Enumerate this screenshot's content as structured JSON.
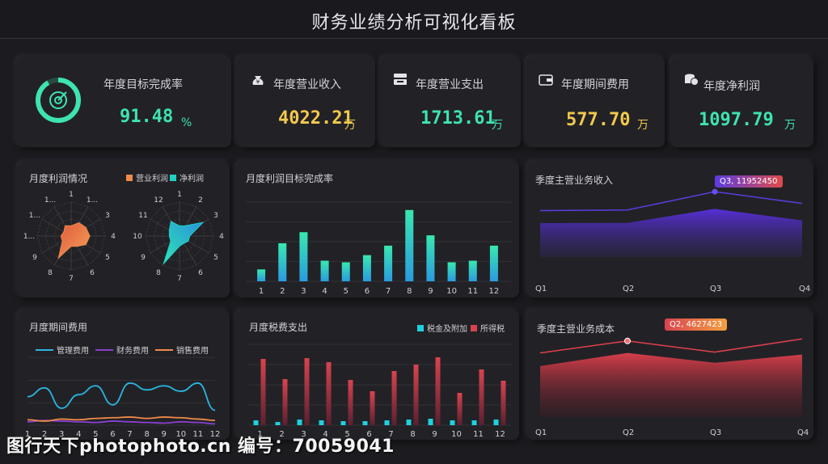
{
  "header": {
    "title": "财务业绩分析可视化看板"
  },
  "kpis": [
    {
      "label": "年度目标完成率",
      "value": "91.48",
      "unit": "%",
      "color": "#3ee3b0",
      "icon": "target-ring-icon"
    },
    {
      "label": "年度营业收入",
      "value": "4022.21",
      "unit": "万",
      "color": "#f2c94c",
      "icon": "money-bag-icon"
    },
    {
      "label": "年度营业支出",
      "value": "1713.61",
      "unit": "万",
      "color": "#3ee3b0",
      "icon": "cash-register-icon"
    },
    {
      "label": "年度期间费用",
      "value": "577.70",
      "unit": "万",
      "color": "#f2c94c",
      "icon": "wallet-icon"
    },
    {
      "label": "年度净利润",
      "value": "1097.79",
      "unit": "万",
      "color": "#3ee3b0",
      "icon": "coin-stack-icon"
    }
  ],
  "panels": {
    "profit_radar": {
      "title": "月度利润情况",
      "legend": [
        "营业利润",
        "净利润"
      ]
    },
    "profit_target": {
      "title": "月度利润目标完成率"
    },
    "quarter_revenue": {
      "title": "季度主营业务收入",
      "tooltip": "Q3, 11952450"
    },
    "period_expense": {
      "title": "月度期间费用",
      "legend": [
        "管理费用",
        "财务费用",
        "销售费用"
      ]
    },
    "tax": {
      "title": "月度税费支出",
      "legend": [
        "税金及附加",
        "所得税"
      ]
    },
    "quarter_cost": {
      "title": "季度主营业务成本",
      "tooltip": "Q2, 4627423"
    }
  },
  "watermark": "图行天下photophoto.cn 编号：70059041",
  "colors": {
    "green": "#3ee3b0",
    "yellow": "#f2c94c",
    "orange": "#f08a4b",
    "teal": "#1fd1c4",
    "blue": "#2ab6e0",
    "purple": "#6a3be0",
    "red": "#d9434f"
  },
  "chart_data": [
    {
      "type": "radar",
      "title": "月度利润情况",
      "categories": [
        "1",
        "2",
        "3",
        "4",
        "5",
        "6",
        "7",
        "8",
        "9",
        "10",
        "11",
        "12"
      ],
      "tick_labels_left": [
        "1",
        "1...",
        "3",
        "4",
        "5",
        "6",
        "7",
        "8",
        "9",
        "1...",
        "1...",
        "1..."
      ],
      "series": [
        {
          "name": "营业利润",
          "values": [
            0.3,
            0.45,
            0.5,
            0.55,
            0.5,
            0.35,
            0.3,
            0.75,
            0.3,
            0.3,
            0.25,
            0.35
          ]
        },
        {
          "name": "净利润",
          "values": [
            0.3,
            0.35,
            0.8,
            0.3,
            0.3,
            0.25,
            0.3,
            0.95,
            0.3,
            0.3,
            0.35,
            0.5
          ]
        }
      ]
    },
    {
      "type": "bar",
      "title": "月度利润目标完成率",
      "categories": [
        "1",
        "2",
        "3",
        "4",
        "5",
        "6",
        "7",
        "8",
        "9",
        "10",
        "11",
        "12"
      ],
      "values": [
        15,
        48,
        62,
        26,
        24,
        33,
        45,
        90,
        58,
        24,
        26,
        45
      ],
      "ylim": [
        0,
        100
      ]
    },
    {
      "type": "area",
      "title": "季度主营业务收入",
      "categories": [
        "Q1",
        "Q2",
        "Q3",
        "Q4"
      ],
      "series": [
        {
          "values": [
            8500000,
            8600000,
            11952450,
            9800000
          ]
        },
        {
          "values": [
            6200000,
            6250000,
            8800000,
            6700000
          ]
        }
      ],
      "ylim": [
        0,
        13000000
      ]
    },
    {
      "type": "line",
      "title": "月度期间费用",
      "categories": [
        "1",
        "2",
        "3",
        "4",
        "5",
        "6",
        "7",
        "8",
        "9",
        "10",
        "11",
        "12"
      ],
      "series": [
        {
          "name": "管理费用",
          "values": [
            42,
            55,
            25,
            45,
            58,
            30,
            62,
            52,
            58,
            50,
            62,
            22
          ]
        },
        {
          "name": "财务费用",
          "values": [
            5,
            7,
            6,
            5,
            4,
            6,
            5,
            4,
            3,
            5,
            4,
            2
          ]
        },
        {
          "name": "销售费用",
          "values": [
            8,
            6,
            9,
            8,
            10,
            11,
            12,
            10,
            12,
            11,
            9,
            7
          ]
        }
      ],
      "ylim": [
        0,
        100
      ]
    },
    {
      "type": "bar",
      "title": "月度税费支出",
      "categories": [
        "1",
        "2",
        "3",
        "4",
        "5",
        "6",
        "7",
        "8",
        "9",
        "10",
        "11",
        "12"
      ],
      "series": [
        {
          "name": "税金及附加",
          "values": [
            6,
            4,
            7,
            6,
            5,
            5,
            6,
            7,
            8,
            6,
            6,
            7
          ]
        },
        {
          "name": "所得税",
          "values": [
            82,
            57,
            83,
            78,
            56,
            42,
            67,
            75,
            84,
            40,
            69,
            55
          ]
        }
      ],
      "ylim": [
        0,
        100
      ]
    },
    {
      "type": "area",
      "title": "季度主营业务成本",
      "categories": [
        "Q1",
        "Q2",
        "Q3",
        "Q4"
      ],
      "series": [
        {
          "values": [
            3900000,
            4627423,
            3950000,
            4750000
          ]
        },
        {
          "values": [
            3100000,
            3900000,
            3300000,
            3800000
          ]
        }
      ],
      "ylim": [
        0,
        5500000
      ]
    }
  ]
}
